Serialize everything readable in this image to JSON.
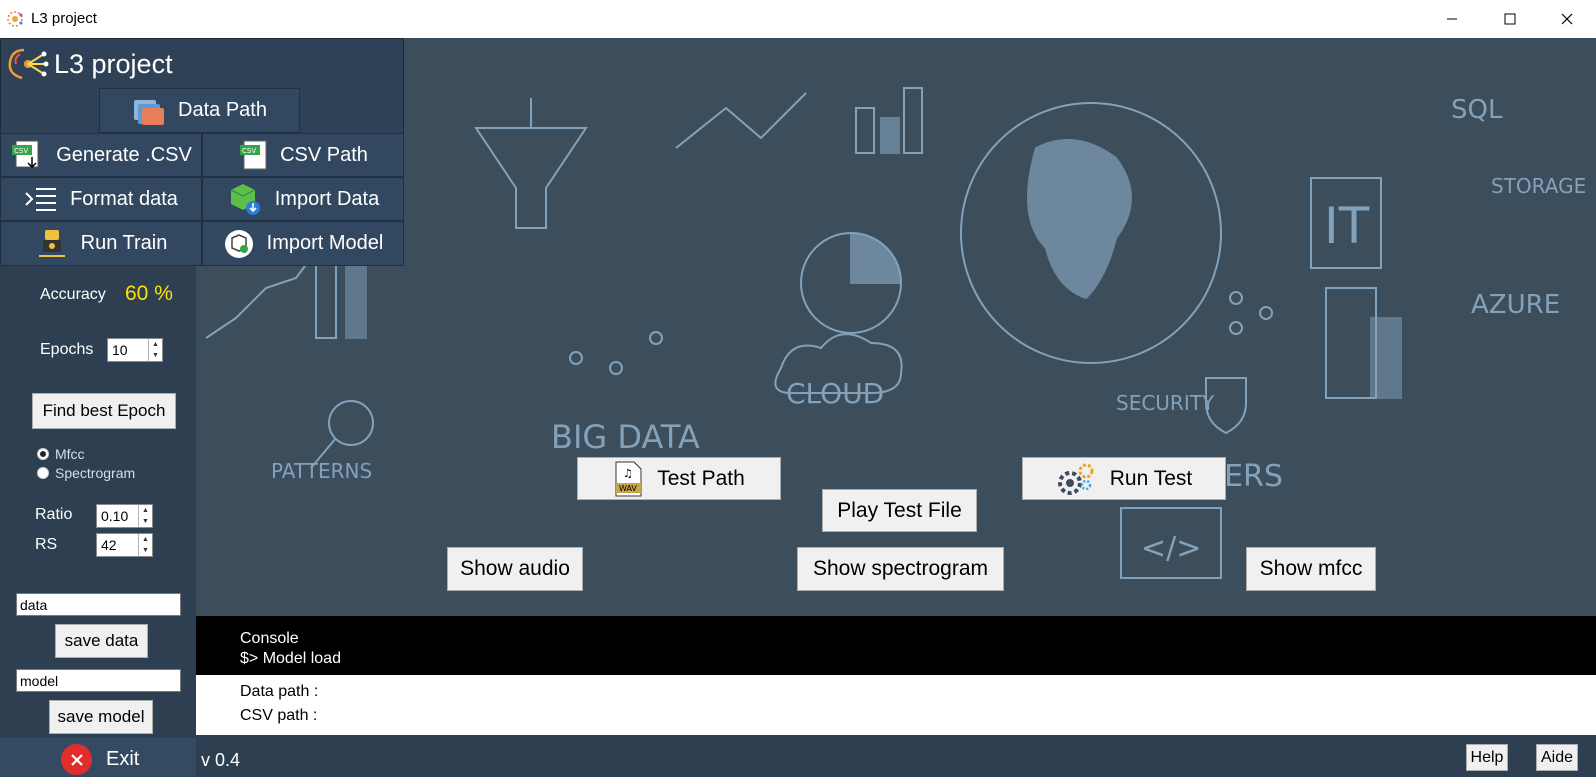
{
  "window": {
    "title": "L3 project"
  },
  "brand": {
    "text": "L3 project"
  },
  "menu": {
    "data_path": "Data Path",
    "generate_csv": "Generate .CSV",
    "csv_path": "CSV Path",
    "format_data": "Format data",
    "import_data": "Import Data",
    "run_train": "Run Train",
    "import_model": "Import Model"
  },
  "params": {
    "accuracy_label": "Accuracy",
    "accuracy_value": "60 %",
    "epochs_label": "Epochs",
    "epochs_value": "10",
    "find_best_epoch": "Find best Epoch",
    "radio_mfcc": "Mfcc",
    "radio_spectrogram": "Spectrogram",
    "radio_selected": "Mfcc",
    "ratio_label": "Ratio",
    "ratio_value": "0.10",
    "rs_label": "RS",
    "rs_value": "42"
  },
  "save": {
    "data_input": "data",
    "save_data": "save data",
    "model_input": "model",
    "save_model": "save model"
  },
  "exit": {
    "label": "Exit"
  },
  "actions": {
    "test_path": "Test Path",
    "play_test_file": "Play Test File",
    "run_test": "Run Test",
    "show_audio": "Show audio",
    "show_spectrogram": "Show spectrogram",
    "show_mfcc": "Show mfcc"
  },
  "console": {
    "title": "Console",
    "output": "$> Model load",
    "data_path": "Data path :",
    "csv_path": "CSV path :"
  },
  "footer": {
    "version": "v 0.4",
    "help": "Help",
    "aide": "Aide"
  },
  "colors": {
    "panel": "#2e3f52",
    "accent_yellow": "#ffe000",
    "background": "#3c4d5c",
    "doodle": "#8fb1cc"
  },
  "icons": {
    "app": "neural-brain-icon",
    "data_path": "folder-icon",
    "generate_csv": "csv-download-icon",
    "csv_path": "csv-file-icon",
    "format_data": "format-list-icon",
    "import_data": "cube-import-icon",
    "run_train": "robot-train-icon",
    "import_model": "box-import-icon",
    "test_path": "wav-file-icon",
    "run_test": "gears-icon",
    "exit": "close-circle-icon"
  }
}
